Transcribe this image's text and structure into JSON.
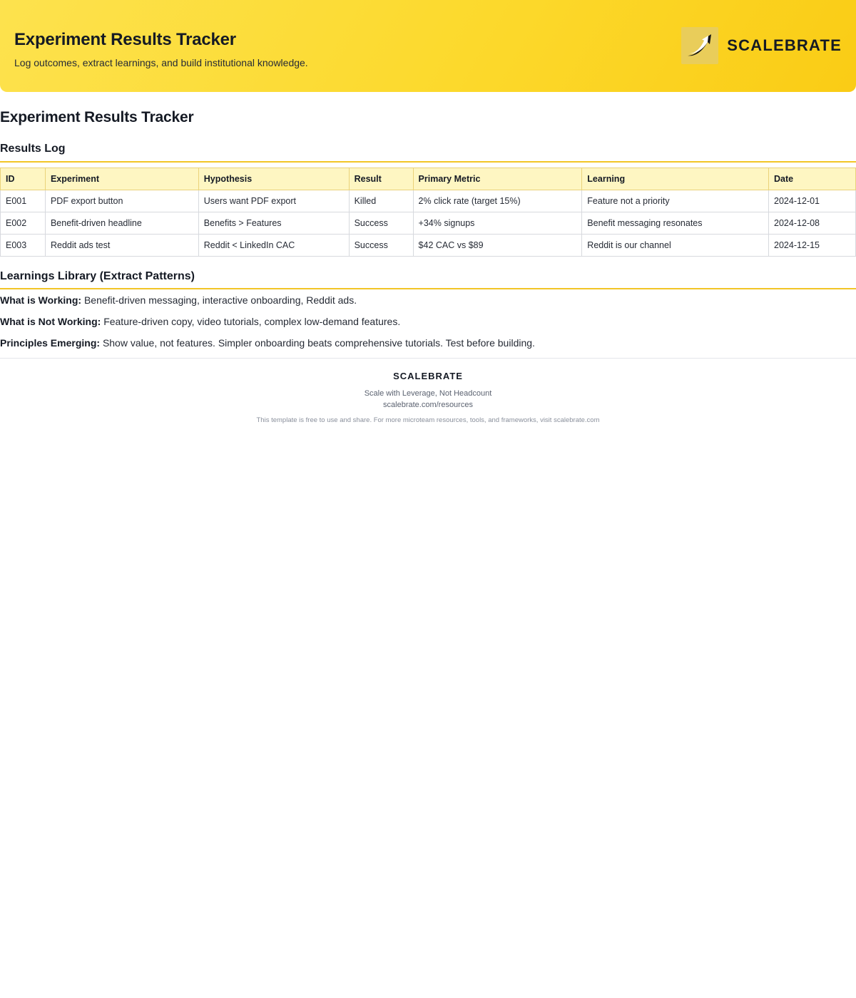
{
  "header": {
    "title": "Experiment Results Tracker",
    "subtitle": "Log outcomes, extract learnings, and build institutional knowledge.",
    "brand": "SCALEBRATE",
    "logo_icon": "rising-arrow-icon",
    "gradient_colors": [
      "#fde24e",
      "#facc15"
    ]
  },
  "page_title": "Experiment Results Tracker",
  "results_log": {
    "heading": "Results Log",
    "columns": [
      "ID",
      "Experiment",
      "Hypothesis",
      "Result",
      "Primary Metric",
      "Learning",
      "Date"
    ],
    "rows": [
      [
        "E001",
        "PDF export button",
        "Users want PDF export",
        "Killed",
        "2% click rate (target 15%)",
        "Feature not a priority",
        "2024-12-01"
      ],
      [
        "E002",
        "Benefit-driven headline",
        "Benefits > Features",
        "Success",
        "+34% signups",
        "Benefit messaging resonates",
        "2024-12-08"
      ],
      [
        "E003",
        "Reddit ads test",
        "Reddit < LinkedIn CAC",
        "Success",
        "$42 CAC vs $89",
        "Reddit is our channel",
        "2024-12-15"
      ]
    ]
  },
  "learnings": {
    "heading": "Learnings Library (Extract Patterns)",
    "items": [
      {
        "label": "What is Working:",
        "text": "Benefit-driven messaging, interactive onboarding, Reddit ads."
      },
      {
        "label": "What is Not Working:",
        "text": "Feature-driven copy, video tutorials, complex low-demand features."
      },
      {
        "label": "Principles Emerging:",
        "text": "Show value, not features. Simpler onboarding beats comprehensive tutorials. Test before building."
      }
    ]
  },
  "footer": {
    "brand": "SCALEBRATE",
    "tagline": "Scale with Leverage, Not Headcount",
    "url": "scalebrate.com/resources",
    "note": "This template is free to use and share. For more microteam resources, tools, and frameworks, visit scalebrate.com"
  },
  "colors": {
    "accent": "#f2c526",
    "table_header_bg": "#fef6c2",
    "text_dark": "#151a24"
  }
}
